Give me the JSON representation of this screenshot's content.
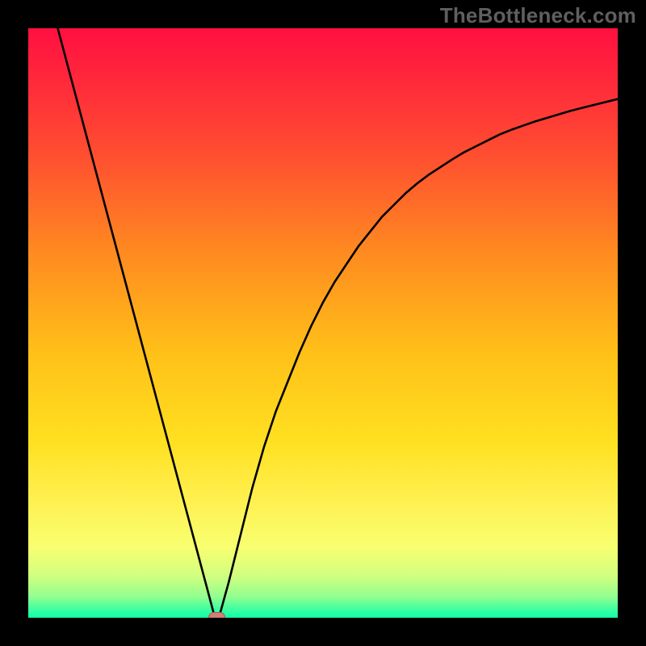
{
  "watermark": "TheBottleneck.com",
  "colors": {
    "frame": "#000000",
    "curve": "#000000",
    "marker_fill": "#cf8077",
    "marker_stroke": "#a85a50",
    "gradient_stops": [
      {
        "offset": 0.0,
        "color": "#ff1040"
      },
      {
        "offset": 0.1,
        "color": "#ff2c3a"
      },
      {
        "offset": 0.22,
        "color": "#ff5030"
      },
      {
        "offset": 0.38,
        "color": "#ff8a20"
      },
      {
        "offset": 0.55,
        "color": "#ffc018"
      },
      {
        "offset": 0.7,
        "color": "#ffe020"
      },
      {
        "offset": 0.8,
        "color": "#fff050"
      },
      {
        "offset": 0.88,
        "color": "#f8ff70"
      },
      {
        "offset": 0.93,
        "color": "#d0ff80"
      },
      {
        "offset": 0.965,
        "color": "#90ff90"
      },
      {
        "offset": 0.985,
        "color": "#40ffa0"
      },
      {
        "offset": 1.0,
        "color": "#10ffa8"
      }
    ]
  },
  "chart_data": {
    "type": "line",
    "title": "",
    "xlabel": "",
    "ylabel": "",
    "xlim": [
      0,
      100
    ],
    "ylim": [
      0,
      100
    ],
    "x": [
      5,
      6,
      7,
      8,
      9,
      10,
      11,
      12,
      13,
      14,
      15,
      16,
      17,
      18,
      19,
      20,
      21,
      22,
      23,
      24,
      25,
      26,
      27,
      28,
      29,
      30,
      31,
      31.5,
      32,
      32.5,
      33,
      34,
      35,
      36,
      37,
      38,
      39,
      40,
      42,
      44,
      46,
      48,
      50,
      52,
      54,
      56,
      58,
      60,
      62,
      64,
      66,
      68,
      70,
      72,
      74,
      76,
      78,
      80,
      82,
      84,
      86,
      88,
      90,
      92,
      94,
      96,
      98,
      100
    ],
    "values": [
      100,
      96.25,
      92.5,
      88.75,
      85,
      81.25,
      77.5,
      73.75,
      70,
      66.25,
      62.5,
      58.75,
      55,
      51.25,
      47.5,
      43.75,
      40,
      36.25,
      32.5,
      28.75,
      25,
      21.25,
      17.5,
      13.75,
      10,
      6.25,
      2.5,
      0.6,
      0,
      0.6,
      2.4,
      6,
      10,
      14,
      18,
      22,
      25.5,
      29,
      35,
      40,
      45,
      49.5,
      53.5,
      57,
      60,
      63,
      65.5,
      68,
      70,
      72,
      73.7,
      75.2,
      76.5,
      77.8,
      79,
      80,
      81,
      82,
      82.8,
      83.5,
      84.2,
      84.8,
      85.4,
      86,
      86.5,
      87,
      87.5,
      88
    ],
    "marker": {
      "x": 32,
      "y": 0
    }
  }
}
